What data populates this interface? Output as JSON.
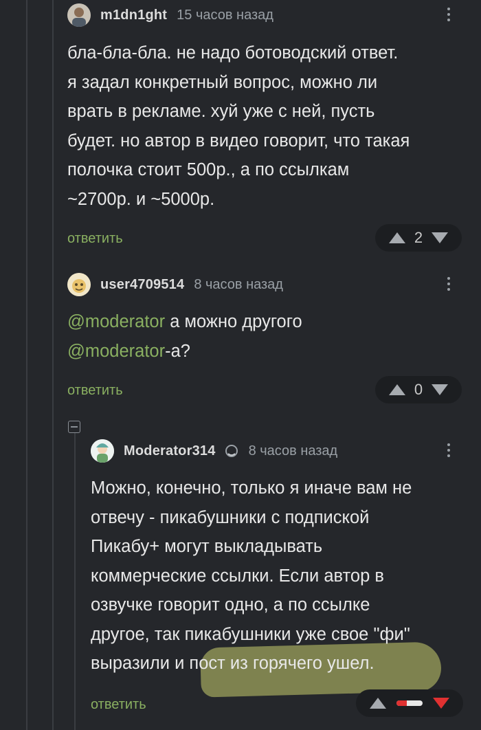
{
  "comments": [
    {
      "username": "m1dn1ght",
      "time": "15 часов назад",
      "lines": [
        "бла-бла-бла. не надо ботоводский ответ.",
        "я задал конкретный вопрос, можно ли",
        "врать в рекламе. хуй уже с ней, пусть",
        "будет. но автор в видео говорит, что такая",
        "полочка стоит 500р., а по ссылкам",
        "~2700р. и ~5000р."
      ],
      "reply_label": "ответить",
      "score": "2"
    },
    {
      "username": "user4709514",
      "time": "8 часов назад",
      "line1_mention": "@moderator",
      "line1_rest": " а можно другого",
      "line2_mention": "@moderator",
      "line2_rest": "-а?",
      "reply_label": "ответить",
      "score": "0"
    },
    {
      "username": "Moderator314",
      "time": "8 часов назад",
      "badge_icon": "moderator-badge-icon",
      "lines": [
        "Можно, конечно, только я иначе вам не",
        "отвечу - пикабушники с подпиской",
        "Пикабу+ могут выкладывать",
        "коммерческие ссылки. Если автор в",
        "озвучке говорит одно, а по ссылке",
        "другое, так пикабушники уже свое \"фи\"",
        "выразили и пост из горячего ушел."
      ],
      "reply_label": "ответить",
      "rating_fraction_negative": 0.4
    }
  ],
  "colors": {
    "background": "#25272b",
    "accent_green": "#8ab061",
    "downvote_red": "#e03131",
    "vote_box": "#1c1e21"
  }
}
